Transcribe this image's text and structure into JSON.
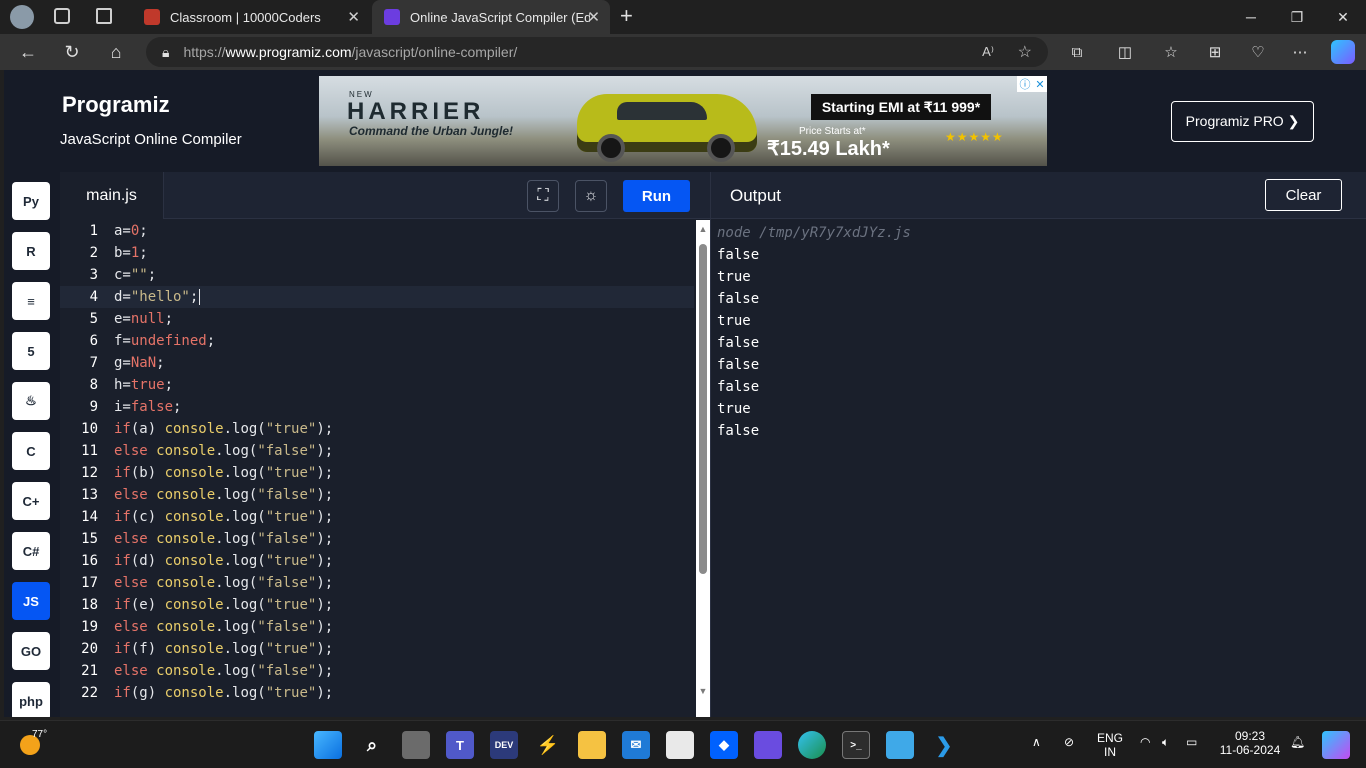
{
  "browser": {
    "tabs": [
      {
        "title": "Classroom | 10000Coders",
        "active": false
      },
      {
        "title": "Online JavaScript Compiler (Edito",
        "active": true
      }
    ],
    "url_prefix": "https://",
    "url_host": "www.programiz.com",
    "url_path": "/javascript/online-compiler/",
    "read_aloud": "A⁾"
  },
  "header": {
    "logo": "Programiz",
    "subtitle": "JavaScript Online Compiler",
    "pro_button": "Programiz PRO ❯"
  },
  "ad": {
    "new_label": "NEW",
    "brand": "HARRIER",
    "tagline": "Command the Urban Jungle!",
    "emi": "Starting EMI at ₹11 999*",
    "price_label": "Price Starts at*",
    "price": "₹15.49 Lakh*",
    "rating": "★★★★★"
  },
  "languages": [
    {
      "name": "python-icon",
      "glyph": "Py",
      "active": false
    },
    {
      "name": "r-icon",
      "glyph": "R",
      "active": false
    },
    {
      "name": "sql-icon",
      "glyph": "≡",
      "active": false
    },
    {
      "name": "html-icon",
      "glyph": "5",
      "active": false
    },
    {
      "name": "java-icon",
      "glyph": "♨",
      "active": false
    },
    {
      "name": "c-icon",
      "glyph": "C",
      "active": false
    },
    {
      "name": "cpp-icon",
      "glyph": "C+",
      "active": false
    },
    {
      "name": "csharp-icon",
      "glyph": "C#",
      "active": false
    },
    {
      "name": "js-icon",
      "glyph": "JS",
      "active": true
    },
    {
      "name": "go-icon",
      "glyph": "GO",
      "active": false
    },
    {
      "name": "php-icon",
      "glyph": "php",
      "active": false
    }
  ],
  "editor": {
    "file_name": "main.js",
    "run_label": "Run",
    "lines": [
      [
        [
          "pl",
          "a="
        ],
        [
          "kw",
          "0"
        ],
        [
          "pl",
          ";"
        ]
      ],
      [
        [
          "pl",
          "b="
        ],
        [
          "kw",
          "1"
        ],
        [
          "pl",
          ";"
        ]
      ],
      [
        [
          "pl",
          "c="
        ],
        [
          "str",
          "\"\""
        ],
        [
          "pl",
          ";"
        ]
      ],
      [
        [
          "pl",
          "d="
        ],
        [
          "str",
          "\"hello\""
        ],
        [
          "pl",
          ";"
        ]
      ],
      [
        [
          "pl",
          "e="
        ],
        [
          "kw",
          "null"
        ],
        [
          "pl",
          ";"
        ]
      ],
      [
        [
          "pl",
          "f="
        ],
        [
          "kw",
          "undefined"
        ],
        [
          "pl",
          ";"
        ]
      ],
      [
        [
          "pl",
          "g="
        ],
        [
          "kw",
          "NaN"
        ],
        [
          "pl",
          ";"
        ]
      ],
      [
        [
          "pl",
          "h="
        ],
        [
          "kw",
          "true"
        ],
        [
          "pl",
          ";"
        ]
      ],
      [
        [
          "pl",
          "i="
        ],
        [
          "kw",
          "false"
        ],
        [
          "pl",
          ";"
        ]
      ],
      [
        [
          "kw",
          "if"
        ],
        [
          "pl",
          "(a) "
        ],
        [
          "obj",
          "console"
        ],
        [
          "pl",
          ".log("
        ],
        [
          "str",
          "\"true\""
        ],
        [
          "pl",
          ");"
        ]
      ],
      [
        [
          "kw",
          "else"
        ],
        [
          "pl",
          " "
        ],
        [
          "obj",
          "console"
        ],
        [
          "pl",
          ".log("
        ],
        [
          "str",
          "\"false\""
        ],
        [
          "pl",
          ");"
        ]
      ],
      [
        [
          "kw",
          "if"
        ],
        [
          "pl",
          "(b) "
        ],
        [
          "obj",
          "console"
        ],
        [
          "pl",
          ".log("
        ],
        [
          "str",
          "\"true\""
        ],
        [
          "pl",
          ");"
        ]
      ],
      [
        [
          "kw",
          "else"
        ],
        [
          "pl",
          " "
        ],
        [
          "obj",
          "console"
        ],
        [
          "pl",
          ".log("
        ],
        [
          "str",
          "\"false\""
        ],
        [
          "pl",
          ");"
        ]
      ],
      [
        [
          "kw",
          "if"
        ],
        [
          "pl",
          "(c) "
        ],
        [
          "obj",
          "console"
        ],
        [
          "pl",
          ".log("
        ],
        [
          "str",
          "\"true\""
        ],
        [
          "pl",
          ");"
        ]
      ],
      [
        [
          "kw",
          "else"
        ],
        [
          "pl",
          " "
        ],
        [
          "obj",
          "console"
        ],
        [
          "pl",
          ".log("
        ],
        [
          "str",
          "\"false\""
        ],
        [
          "pl",
          ");"
        ]
      ],
      [
        [
          "kw",
          "if"
        ],
        [
          "pl",
          "(d) "
        ],
        [
          "obj",
          "console"
        ],
        [
          "pl",
          ".log("
        ],
        [
          "str",
          "\"true\""
        ],
        [
          "pl",
          ");"
        ]
      ],
      [
        [
          "kw",
          "else"
        ],
        [
          "pl",
          " "
        ],
        [
          "obj",
          "console"
        ],
        [
          "pl",
          ".log("
        ],
        [
          "str",
          "\"false\""
        ],
        [
          "pl",
          ");"
        ]
      ],
      [
        [
          "kw",
          "if"
        ],
        [
          "pl",
          "(e) "
        ],
        [
          "obj",
          "console"
        ],
        [
          "pl",
          ".log("
        ],
        [
          "str",
          "\"true\""
        ],
        [
          "pl",
          ");"
        ]
      ],
      [
        [
          "kw",
          "else"
        ],
        [
          "pl",
          " "
        ],
        [
          "obj",
          "console"
        ],
        [
          "pl",
          ".log("
        ],
        [
          "str",
          "\"false\""
        ],
        [
          "pl",
          ");"
        ]
      ],
      [
        [
          "kw",
          "if"
        ],
        [
          "pl",
          "(f) "
        ],
        [
          "obj",
          "console"
        ],
        [
          "pl",
          ".log("
        ],
        [
          "str",
          "\"true\""
        ],
        [
          "pl",
          ");"
        ]
      ],
      [
        [
          "kw",
          "else"
        ],
        [
          "pl",
          " "
        ],
        [
          "obj",
          "console"
        ],
        [
          "pl",
          ".log("
        ],
        [
          "str",
          "\"false\""
        ],
        [
          "pl",
          ");"
        ]
      ],
      [
        [
          "kw",
          "if"
        ],
        [
          "pl",
          "(g) "
        ],
        [
          "obj",
          "console"
        ],
        [
          "pl",
          ".log("
        ],
        [
          "str",
          "\"true\""
        ],
        [
          "pl",
          ");"
        ]
      ]
    ],
    "current_line": 4
  },
  "output": {
    "title": "Output",
    "clear_label": "Clear",
    "command": "node /tmp/yR7y7xdJYz.js",
    "lines": [
      "false",
      "true",
      "false",
      "true",
      "false",
      "false",
      "false",
      "true",
      "false"
    ]
  },
  "taskbar": {
    "weather_temp": "77°",
    "lang_top": "ENG",
    "lang_bottom": "IN",
    "time": "09:23",
    "date": "11-06-2024"
  },
  "colors": {
    "accent": "#0556f3",
    "editor_bg": "#1a1f2b",
    "keyword": "#e57368",
    "string": "#c9b98a",
    "object": "#e9cd6a"
  }
}
